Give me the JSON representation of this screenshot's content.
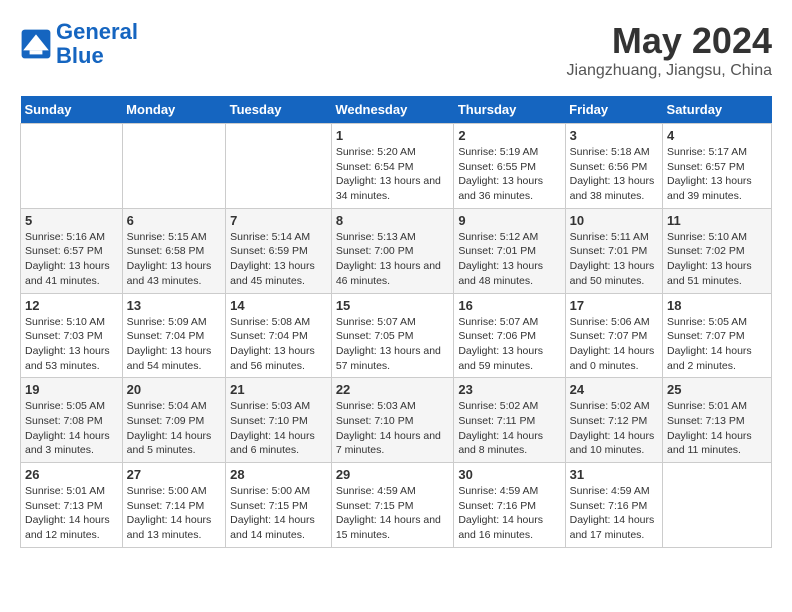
{
  "header": {
    "logo_line1": "General",
    "logo_line2": "Blue",
    "main_title": "May 2024",
    "subtitle": "Jiangzhuang, Jiangsu, China"
  },
  "days_of_week": [
    "Sunday",
    "Monday",
    "Tuesday",
    "Wednesday",
    "Thursday",
    "Friday",
    "Saturday"
  ],
  "weeks": [
    [
      {
        "day": "",
        "info": ""
      },
      {
        "day": "",
        "info": ""
      },
      {
        "day": "",
        "info": ""
      },
      {
        "day": "1",
        "info": "Sunrise: 5:20 AM\nSunset: 6:54 PM\nDaylight: 13 hours\nand 34 minutes."
      },
      {
        "day": "2",
        "info": "Sunrise: 5:19 AM\nSunset: 6:55 PM\nDaylight: 13 hours\nand 36 minutes."
      },
      {
        "day": "3",
        "info": "Sunrise: 5:18 AM\nSunset: 6:56 PM\nDaylight: 13 hours\nand 38 minutes."
      },
      {
        "day": "4",
        "info": "Sunrise: 5:17 AM\nSunset: 6:57 PM\nDaylight: 13 hours\nand 39 minutes."
      }
    ],
    [
      {
        "day": "5",
        "info": "Sunrise: 5:16 AM\nSunset: 6:57 PM\nDaylight: 13 hours\nand 41 minutes."
      },
      {
        "day": "6",
        "info": "Sunrise: 5:15 AM\nSunset: 6:58 PM\nDaylight: 13 hours\nand 43 minutes."
      },
      {
        "day": "7",
        "info": "Sunrise: 5:14 AM\nSunset: 6:59 PM\nDaylight: 13 hours\nand 45 minutes."
      },
      {
        "day": "8",
        "info": "Sunrise: 5:13 AM\nSunset: 7:00 PM\nDaylight: 13 hours\nand 46 minutes."
      },
      {
        "day": "9",
        "info": "Sunrise: 5:12 AM\nSunset: 7:01 PM\nDaylight: 13 hours\nand 48 minutes."
      },
      {
        "day": "10",
        "info": "Sunrise: 5:11 AM\nSunset: 7:01 PM\nDaylight: 13 hours\nand 50 minutes."
      },
      {
        "day": "11",
        "info": "Sunrise: 5:10 AM\nSunset: 7:02 PM\nDaylight: 13 hours\nand 51 minutes."
      }
    ],
    [
      {
        "day": "12",
        "info": "Sunrise: 5:10 AM\nSunset: 7:03 PM\nDaylight: 13 hours\nand 53 minutes."
      },
      {
        "day": "13",
        "info": "Sunrise: 5:09 AM\nSunset: 7:04 PM\nDaylight: 13 hours\nand 54 minutes."
      },
      {
        "day": "14",
        "info": "Sunrise: 5:08 AM\nSunset: 7:04 PM\nDaylight: 13 hours\nand 56 minutes."
      },
      {
        "day": "15",
        "info": "Sunrise: 5:07 AM\nSunset: 7:05 PM\nDaylight: 13 hours\nand 57 minutes."
      },
      {
        "day": "16",
        "info": "Sunrise: 5:07 AM\nSunset: 7:06 PM\nDaylight: 13 hours\nand 59 minutes."
      },
      {
        "day": "17",
        "info": "Sunrise: 5:06 AM\nSunset: 7:07 PM\nDaylight: 14 hours\nand 0 minutes."
      },
      {
        "day": "18",
        "info": "Sunrise: 5:05 AM\nSunset: 7:07 PM\nDaylight: 14 hours\nand 2 minutes."
      }
    ],
    [
      {
        "day": "19",
        "info": "Sunrise: 5:05 AM\nSunset: 7:08 PM\nDaylight: 14 hours\nand 3 minutes."
      },
      {
        "day": "20",
        "info": "Sunrise: 5:04 AM\nSunset: 7:09 PM\nDaylight: 14 hours\nand 5 minutes."
      },
      {
        "day": "21",
        "info": "Sunrise: 5:03 AM\nSunset: 7:10 PM\nDaylight: 14 hours\nand 6 minutes."
      },
      {
        "day": "22",
        "info": "Sunrise: 5:03 AM\nSunset: 7:10 PM\nDaylight: 14 hours\nand 7 minutes."
      },
      {
        "day": "23",
        "info": "Sunrise: 5:02 AM\nSunset: 7:11 PM\nDaylight: 14 hours\nand 8 minutes."
      },
      {
        "day": "24",
        "info": "Sunrise: 5:02 AM\nSunset: 7:12 PM\nDaylight: 14 hours\nand 10 minutes."
      },
      {
        "day": "25",
        "info": "Sunrise: 5:01 AM\nSunset: 7:13 PM\nDaylight: 14 hours\nand 11 minutes."
      }
    ],
    [
      {
        "day": "26",
        "info": "Sunrise: 5:01 AM\nSunset: 7:13 PM\nDaylight: 14 hours\nand 12 minutes."
      },
      {
        "day": "27",
        "info": "Sunrise: 5:00 AM\nSunset: 7:14 PM\nDaylight: 14 hours\nand 13 minutes."
      },
      {
        "day": "28",
        "info": "Sunrise: 5:00 AM\nSunset: 7:15 PM\nDaylight: 14 hours\nand 14 minutes."
      },
      {
        "day": "29",
        "info": "Sunrise: 4:59 AM\nSunset: 7:15 PM\nDaylight: 14 hours\nand 15 minutes."
      },
      {
        "day": "30",
        "info": "Sunrise: 4:59 AM\nSunset: 7:16 PM\nDaylight: 14 hours\nand 16 minutes."
      },
      {
        "day": "31",
        "info": "Sunrise: 4:59 AM\nSunset: 7:16 PM\nDaylight: 14 hours\nand 17 minutes."
      },
      {
        "day": "",
        "info": ""
      }
    ]
  ]
}
